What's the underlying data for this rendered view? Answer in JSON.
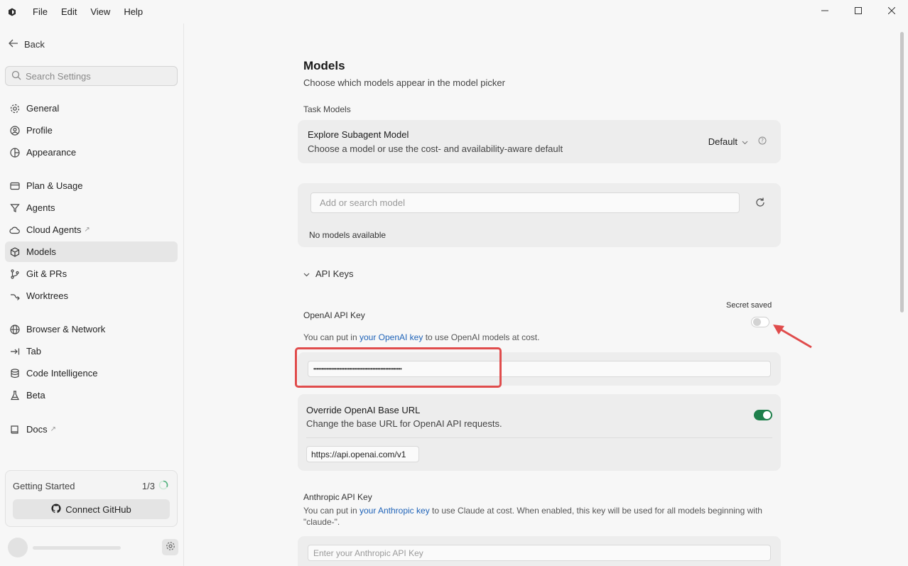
{
  "menu": {
    "file": "File",
    "edit": "Edit",
    "view": "View",
    "help": "Help"
  },
  "sidebar": {
    "back": "Back",
    "search_placeholder": "Search Settings",
    "items": [
      {
        "label": "General",
        "icon": "gear-icon"
      },
      {
        "label": "Profile",
        "icon": "user-circle-icon"
      },
      {
        "label": "Appearance",
        "icon": "palette-icon"
      },
      {
        "label": "Plan & Usage",
        "icon": "card-icon"
      },
      {
        "label": "Agents",
        "icon": "funnel-icon"
      },
      {
        "label": "Cloud Agents",
        "icon": "cloud-icon",
        "external": "↗"
      },
      {
        "label": "Models",
        "icon": "cube-icon",
        "active": true
      },
      {
        "label": "Git & PRs",
        "icon": "git-branch-icon"
      },
      {
        "label": "Worktrees",
        "icon": "worktree-icon"
      },
      {
        "label": "Browser & Network",
        "icon": "globe-icon"
      },
      {
        "label": "Tab",
        "icon": "tab-arrow-icon"
      },
      {
        "label": "Code Intelligence",
        "icon": "database-icon"
      },
      {
        "label": "Beta",
        "icon": "flask-icon"
      },
      {
        "label": "Docs",
        "icon": "book-icon",
        "external": "↗"
      }
    ],
    "getting_started": {
      "title": "Getting Started",
      "count": "1/3",
      "button": "Connect GitHub"
    }
  },
  "main": {
    "title": "Models",
    "subtitle": "Choose which models appear in the model picker",
    "task_models_label": "Task Models",
    "explore": {
      "title": "Explore Subagent Model",
      "desc": "Choose a model or use the cost- and availability-aware default",
      "value": "Default"
    },
    "model_search_placeholder": "Add or search model",
    "no_models": "No models available",
    "api_keys_label": "API Keys",
    "openai": {
      "label": "OpenAI API Key",
      "secret_saved": "Secret saved",
      "desc_prefix": "You can put in ",
      "desc_link": "your OpenAI key",
      "desc_suffix": " to use OpenAI models at cost.",
      "masked_value": "••••••••••••••••••••••••••••••••••••••••••••••••••••••",
      "enabled": false
    },
    "override": {
      "title": "Override OpenAI Base URL",
      "desc": "Change the base URL for OpenAI API requests.",
      "value": "https://api.openai.com/v1",
      "enabled": true
    },
    "anthropic": {
      "label": "Anthropic API Key",
      "desc_prefix": "You can put in ",
      "desc_link": "your Anthropic key",
      "desc_suffix": " to use Claude at cost. When enabled, this key will be used for all models beginning with",
      "desc_line2": "\"claude-\".",
      "placeholder": "Enter your Anthropic API Key"
    }
  },
  "colors": {
    "accent_link": "#1f63b8",
    "toggle_on": "#1e7f4b",
    "annotation_red": "#e04c4c"
  }
}
